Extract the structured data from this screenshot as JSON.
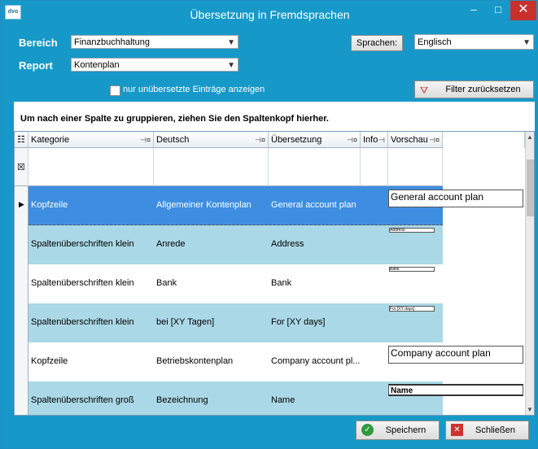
{
  "window": {
    "app_icon_text": "dvo",
    "title": "Übersetzung in Fremdsprachen",
    "minimize": "–",
    "maximize": "□",
    "close": "✕"
  },
  "filters": {
    "bereich_label": "Bereich",
    "bereich_value": "Finanzbuchhaltung",
    "report_label": "Report",
    "report_value": "Kontenplan",
    "sprachen_button": "Sprachen:",
    "sprachen_value": "Englisch",
    "checkbox_label": "nur unübersetzte Einträge anzeigen",
    "reset_button": "Filter zurücksetzen"
  },
  "group_hint": "Um nach einer Spalte zu gruppieren, ziehen Sie den Spaltenkopf hierher.",
  "columns": {
    "kategorie": "Kategorie",
    "deutsch": "Deutsch",
    "uebersetzung": "Übersetzung",
    "info": "Info",
    "vorschau": "Vorschau"
  },
  "rows": [
    {
      "kategorie": "Kopfzeile",
      "deutsch": "Allgemeiner Kontenplan",
      "uebersetzung": "General account plan",
      "preview": "General account plan"
    },
    {
      "kategorie": "Spaltenüberschriften klein",
      "deutsch": "Anrede",
      "uebersetzung": "Address",
      "preview": "Address"
    },
    {
      "kategorie": "Spaltenüberschriften klein",
      "deutsch": "Bank",
      "uebersetzung": "Bank",
      "preview": "Bank"
    },
    {
      "kategorie": "Spaltenüberschriften klein",
      "deutsch": "bei [XY Tagen]",
      "uebersetzung": "For [XY days]",
      "preview": "For [XY days]"
    },
    {
      "kategorie": "Kopfzeile",
      "deutsch": "Betriebskontenplan",
      "uebersetzung": "Company account pl...",
      "preview": "Company account plan"
    },
    {
      "kategorie": "Spaltenüberschriften groß",
      "deutsch": "Bezeichnung",
      "uebersetzung": "Name",
      "preview": "Name"
    }
  ],
  "buttons": {
    "save": "Speichern",
    "close": "Schließen"
  },
  "colors": {
    "accent": "#1699c8",
    "selected_row": "#3d8ee0",
    "alt_row": "#aad8e6"
  }
}
